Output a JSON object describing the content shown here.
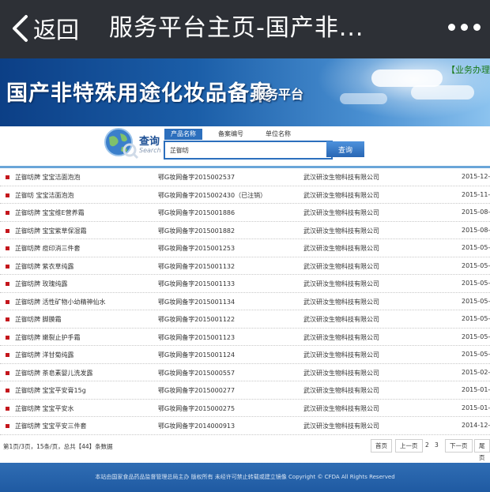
{
  "nav": {
    "back_label": "返回",
    "title": "服务平台主页-国产非..."
  },
  "banner": {
    "title": "国产非特殊用途化妆品备案",
    "subtitle": "服务平台",
    "business_link": "【业务办理"
  },
  "search": {
    "label": "查询",
    "label_en": "Search",
    "tabs": [
      "产品名称",
      "备案编号",
      "单位名称"
    ],
    "active_tab": "产品名称",
    "query": "芷御坊",
    "button_label": "查询"
  },
  "results": [
    {
      "name": "芷御坊牌 宝宝洁面泡泡",
      "number": "鄂G妆网备字2015002537",
      "company": "武汉研汝生物科技有限公司",
      "date": "2015-12-0"
    },
    {
      "name": "芷御坊 宝宝洁面泡泡",
      "number": "鄂G妆网备字2015002430（已注销）",
      "company": "武汉研汝生物科技有限公司",
      "date": "2015-11-"
    },
    {
      "name": "芷御坊牌 宝宝维E营养霜",
      "number": "鄂G妆网备字2015001886",
      "company": "武汉研汝生物科技有限公司",
      "date": "2015-08-"
    },
    {
      "name": "芷御坊牌 宝宝紫草保湿霜",
      "number": "鄂G妆网备字2015001882",
      "company": "武汉研汝生物科技有限公司",
      "date": "2015-08-"
    },
    {
      "name": "芷御坊牌 痘印消三件套",
      "number": "鄂G妆网备字2015001253",
      "company": "武汉研汝生物科技有限公司",
      "date": "2015-05-"
    },
    {
      "name": "芷御坊牌 紫衣草纯露",
      "number": "鄂G妆网备字2015001132",
      "company": "武汉研汝生物科技有限公司",
      "date": "2015-05-2"
    },
    {
      "name": "芷御坊牌 玫瑰纯露",
      "number": "鄂G妆网备字2015001133",
      "company": "武汉研汝生物科技有限公司",
      "date": "2015-05-2"
    },
    {
      "name": "芷御坊牌 活性矿物小幼精神仙水",
      "number": "鄂G妆网备字2015001134",
      "company": "武汉研汝生物科技有限公司",
      "date": "2015-05-2"
    },
    {
      "name": "芷御坊牌 脚膜霜",
      "number": "鄂G妆网备字2015001122",
      "company": "武汉研汝生物科技有限公司",
      "date": "2015-05-"
    },
    {
      "name": "芷御坊牌 嫩裂止护手霜",
      "number": "鄂G妆网备字2015001123",
      "company": "武汉研汝生物科技有限公司",
      "date": "2015-05-"
    },
    {
      "name": "芷御坊牌 洋甘菊纯露",
      "number": "鄂G妆网备字2015001124",
      "company": "武汉研汝生物科技有限公司",
      "date": "2015-05-2"
    },
    {
      "name": "芷御坊牌 茶皂素婴儿洗发露",
      "number": "鄂G妆网备字2015000557",
      "company": "武汉研汝生物科技有限公司",
      "date": "2015-02-"
    },
    {
      "name": "芷御坊牌 宝宝平安膏15g",
      "number": "鄂G妆网备字2015000277",
      "company": "武汉研汝生物科技有限公司",
      "date": "2015-01-"
    },
    {
      "name": "芷御坊牌 宝宝平安水",
      "number": "鄂G妆网备字2015000275",
      "company": "武汉研汝生物科技有限公司",
      "date": "2015-01-"
    },
    {
      "name": "芷御坊牌 宝宝平安三件套",
      "number": "鄂G妆网备字2014000913",
      "company": "武汉研汝生物科技有限公司",
      "date": "2014-12-"
    }
  ],
  "pager": {
    "info": "第1页/3页，15条/页，总共【44】条数据",
    "first": "首页",
    "prev": "上一页",
    "page2": "2",
    "page3": "3",
    "next": "下一页",
    "last": "尾页"
  },
  "footer": {
    "text": "本站由国家食品药品监督管理总局主办 版权所有 未经许可禁止转载或建立镜像 Copyright © CFDA All Rights Reserved"
  },
  "colors": {
    "navbar": "#2d3036",
    "banner_dark": "#0c3f86",
    "accent": "#2c6fbd",
    "bullet": "#c4161c",
    "footer": "#1f5aa2"
  }
}
